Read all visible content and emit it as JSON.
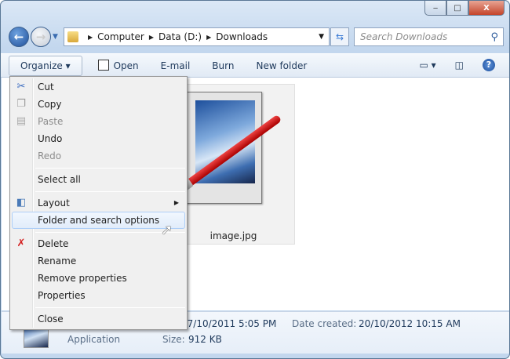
{
  "window": {
    "controls": {
      "minimize": "‒",
      "maximize": "□",
      "close": "X"
    }
  },
  "address": {
    "crumbs": [
      "Computer",
      "Data (D:)",
      "Downloads"
    ]
  },
  "search": {
    "placeholder": "Search Downloads"
  },
  "toolbar": {
    "organize": "Organize ▾",
    "open": "Open",
    "email": "E-mail",
    "burn": "Burn",
    "new_folder": "New folder"
  },
  "file": {
    "name": "image.jpg"
  },
  "details": {
    "type": "Application",
    "modified": "07/10/2011 5:05 PM",
    "created_label": "Date created:",
    "created": "20/10/2012 10:15 AM",
    "size_label": "Size:",
    "size": "912 KB"
  },
  "menu": {
    "cut": "Cut",
    "copy": "Copy",
    "paste": "Paste",
    "undo": "Undo",
    "redo": "Redo",
    "select_all": "Select all",
    "layout": "Layout",
    "folder_options": "Folder and search options",
    "delete": "Delete",
    "rename": "Rename",
    "remove_properties": "Remove properties",
    "properties": "Properties",
    "close": "Close"
  }
}
